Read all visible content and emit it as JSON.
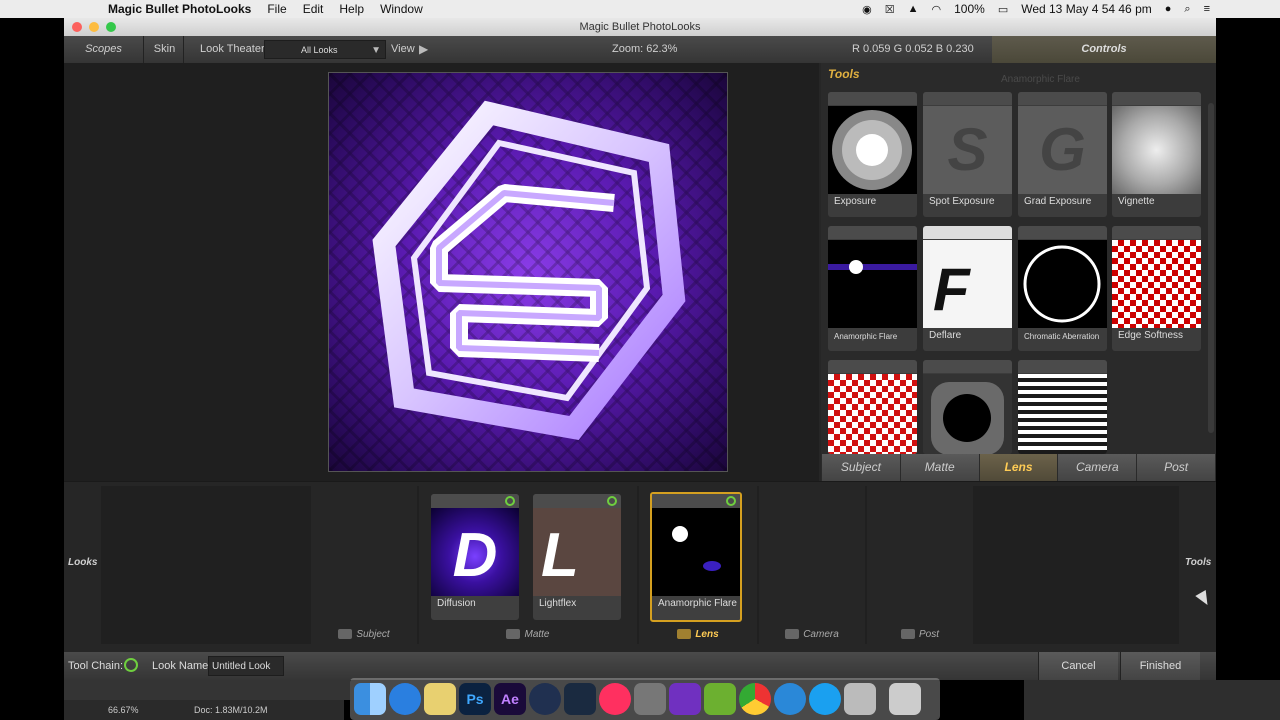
{
  "menubar": {
    "app_name": "Magic Bullet PhotoLooks",
    "items": [
      "File",
      "Edit",
      "Help",
      "Window"
    ],
    "battery": "100%",
    "datetime": "Wed 13 May  4 54 46 pm"
  },
  "window": {
    "title": "Magic Bullet PhotoLooks"
  },
  "topbar": {
    "scopes": "Scopes",
    "skin": "Skin",
    "look_theater": "Look Theater",
    "looks_dropdown": "All Looks",
    "view": "View",
    "zoom": "Zoom:  62.3%",
    "rgb": "R 0.059   G 0.052   B 0.230",
    "controls": "Controls"
  },
  "tools_panel": {
    "title": "Tools",
    "ghost_label": "Anamorphic Flare",
    "tools": [
      {
        "label": "Exposure"
      },
      {
        "label": "Spot Exposure"
      },
      {
        "label": "Grad Exposure"
      },
      {
        "label": "Vignette"
      },
      {
        "label": "Anamorphic Flare"
      },
      {
        "label": "Deflare"
      },
      {
        "label": "Chromatic Aberration"
      },
      {
        "label": "Edge Softness"
      },
      {
        "label": ""
      },
      {
        "label": ""
      },
      {
        "label": ""
      }
    ],
    "categories": [
      "Subject",
      "Matte",
      "Lens",
      "Camera",
      "Post"
    ],
    "active_category": "Lens"
  },
  "chain": {
    "left_label": "Looks",
    "right_label": "Tools",
    "slots": [
      {
        "label": "Subject"
      },
      {
        "label": "Matte"
      },
      {
        "label": "Lens"
      },
      {
        "label": "Camera"
      },
      {
        "label": "Post"
      }
    ],
    "cards": [
      {
        "label": "Diffusion",
        "letter": "D"
      },
      {
        "label": "Lightflex",
        "letter": "L"
      },
      {
        "label": "Anamorphic Flare",
        "letter": ""
      }
    ]
  },
  "bottombar": {
    "tool_chain_label": "Tool Chain:",
    "look_name_label": "Look Name:",
    "look_name_value": "Untitled Look",
    "cancel": "Cancel",
    "finished": "Finished"
  },
  "ps_status": {
    "zoom": "66.67%",
    "doc": "Doc: 1.83M/10.2M"
  },
  "dock": {
    "icons": [
      "finder-icon",
      "safari-icon",
      "preview-icon",
      "photoshop-icon",
      "after-effects-icon",
      "cinema4d-icon",
      "steam-icon",
      "itunes-icon",
      "system-preferences-icon",
      "imovie-icon",
      "android-icon",
      "chrome-icon",
      "edge-icon",
      "skype-icon",
      "gamepad-icon",
      "trash-icon"
    ],
    "photoshop_text": "Ps",
    "after_effects_text": "Ae"
  }
}
